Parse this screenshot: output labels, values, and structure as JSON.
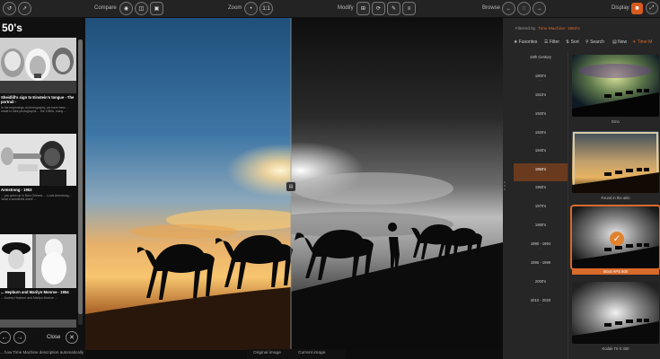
{
  "toolbar": {
    "compare_label": "Compare",
    "zoom_label": "Zoom",
    "zoom_value": "1:1",
    "modify_label": "Modify",
    "browse_label": "Browse",
    "display_label": "Display"
  },
  "left_panel": {
    "title": "50's",
    "articles": [
      {
        "heading": "Sheidlill's sign to Einstein's tongue - The portrait -",
        "text": "In the beginnings of photography, we have been ... made to take photographs ... the 1950s, many ..."
      },
      {
        "heading": "Armstrong - 1953",
        "text": "... you grew up in New Orleans ... Louis Armstrong ... 'what a wonderful world' ..."
      },
      {
        "heading": "... Hepburn and Marilyn Monroe - 1954",
        "text": "... Audrey Hepburn and Marilyn Monroe ..."
      }
    ],
    "close_label": "Close",
    "bottom_text": "... how Time Machine description automatically"
  },
  "viewer": {
    "caption_original": "Original image",
    "caption_current": "Current image"
  },
  "right_panel": {
    "filter_prefix": "Filtered by",
    "filter_value": "Time Machine: 1950's",
    "tools": [
      "Favorites",
      "Filter",
      "Sort",
      "Search",
      "New",
      "Time M"
    ],
    "eras": [
      {
        "name": "19th Century",
        "count": "..."
      },
      {
        "name": "1900's",
        "count": "..."
      },
      {
        "name": "1910's",
        "count": "..."
      },
      {
        "name": "1920's",
        "count": "..."
      },
      {
        "name": "1930's",
        "count": "..."
      },
      {
        "name": "1940's",
        "count": "..."
      },
      {
        "name": "1950's",
        "count": "..."
      },
      {
        "name": "1960's",
        "count": "..."
      },
      {
        "name": "1970's",
        "count": "..."
      },
      {
        "name": "1980's",
        "count": "..."
      },
      {
        "name": "1990 - 1994",
        "count": "..."
      },
      {
        "name": "1995 - 1999",
        "count": "..."
      },
      {
        "name": "2000's",
        "count": "..."
      },
      {
        "name": "2010 - 2020",
        "count": "..."
      }
    ],
    "thumbs": [
      {
        "caption": "Emo"
      },
      {
        "caption": "Found in the attic"
      },
      {
        "caption": "Ilford HPS 800"
      },
      {
        "caption": "Kodak Tri-X 400"
      }
    ]
  }
}
